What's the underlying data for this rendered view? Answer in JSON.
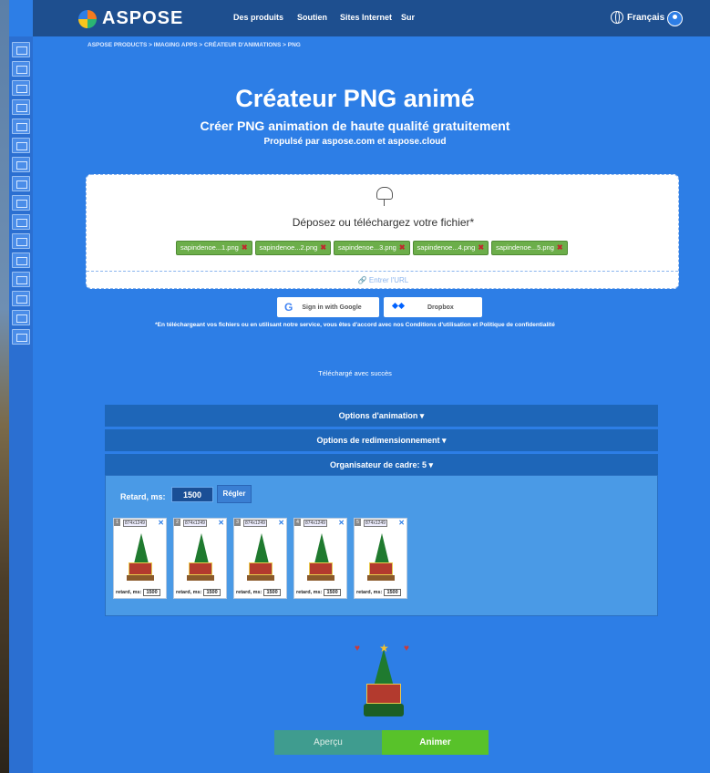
{
  "nav": {
    "brand": "ASPOSE",
    "items": [
      "Des produits",
      "Soutien",
      "Sites Internet",
      "Sur"
    ],
    "language": "Français"
  },
  "breadcrumb": "ASPOSE PRODUCTS > IMAGING APPS > CRÉATEUR D'ANIMATIONS > PNG",
  "hero": {
    "title": "Créateur PNG animé",
    "subtitle": "Créer PNG animation de haute qualité gratuitement",
    "powered_by": "Propulsé par aspose.com et aspose.cloud"
  },
  "upload": {
    "drop_text": "Déposez ou téléchargez votre fichier*",
    "files": [
      "sapindenoe...1.png",
      "sapindenoe...2.png",
      "sapindenoe...3.png",
      "sapindenoe...4.png",
      "sapindenoe...5.png"
    ],
    "url_label": "Entrer l'URL"
  },
  "auth": {
    "google_label": "Sign in with Google",
    "dropbox_label": "Dropbox"
  },
  "terms": "*En téléchargeant vos fichiers ou en utilisant notre service, vous êtes d'accord avec nos Conditions d'utilisation et Politique de confidentialité",
  "status": "Téléchargé avec succès",
  "sections": {
    "animation_options": "Options d'animation ▾",
    "resize_options": "Options de redimensionnement ▾",
    "frame_organizer": "Organisateur de cadre: 5 ▾"
  },
  "frame_panel": {
    "delay_label": "Retard, ms:",
    "delay_value": "1500",
    "apply_label": "Régler",
    "frames": [
      {
        "num": "1",
        "size": "874x1249",
        "delay_label": "retard, ms:",
        "delay": "1500"
      },
      {
        "num": "2",
        "size": "874x1249",
        "delay_label": "retard, ms:",
        "delay": "1500"
      },
      {
        "num": "3",
        "size": "874x1249",
        "delay_label": "retard, ms:",
        "delay": "1500"
      },
      {
        "num": "4",
        "size": "874x1249",
        "delay_label": "retard, ms:",
        "delay": "1500"
      },
      {
        "num": "5",
        "size": "874x1249",
        "delay_label": "retard, ms:",
        "delay": "1500"
      }
    ]
  },
  "actions": {
    "preview_label": "Aperçu",
    "animate_label": "Animer"
  },
  "colors": {
    "background": "#2d7ee6",
    "nav": "#1e4f8f",
    "chip": "#6cae4a",
    "animate": "#58c22a",
    "preview": "#3f9c8f"
  }
}
